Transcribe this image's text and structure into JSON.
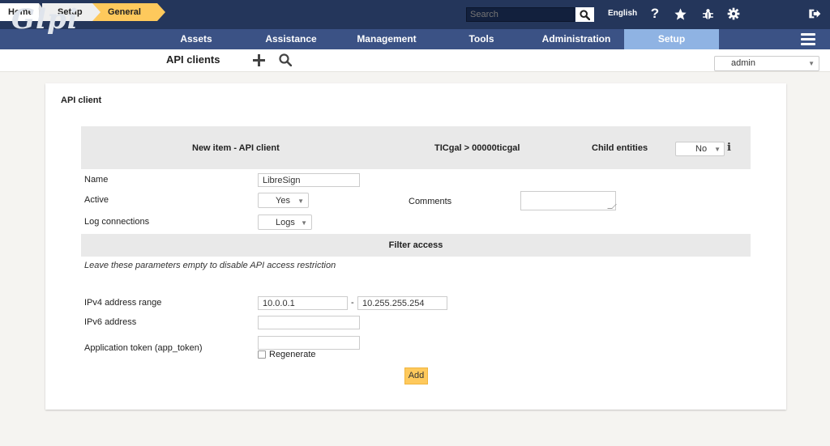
{
  "header": {
    "logo_text": "Glpi",
    "search_placeholder": "Search",
    "language": "English"
  },
  "menu": {
    "items": [
      {
        "label": "Assets"
      },
      {
        "label": "Assistance"
      },
      {
        "label": "Management"
      },
      {
        "label": "Tools"
      },
      {
        "label": "Administration"
      },
      {
        "label": "Setup"
      }
    ]
  },
  "breadcrumb": {
    "home": "Home",
    "setup": "Setup",
    "general": "General",
    "page_title": "API clients"
  },
  "profile_select": {
    "value": "admin"
  },
  "form": {
    "card_title": "API client",
    "header_title": "New item - API client",
    "entity": "TICgal > 00000ticgal",
    "child_entities_label": "Child entities",
    "child_entities_value": "No",
    "name_label": "Name",
    "name_value": "LibreSign",
    "active_label": "Active",
    "active_value": "Yes",
    "comments_label": "Comments",
    "log_label": "Log connections",
    "log_value": "Logs",
    "filter_title": "Filter access",
    "filter_hint": "Leave these parameters empty to disable API access restriction",
    "ipv4_label": "IPv4 address range",
    "ipv4_start": "10.0.0.1",
    "ipv4_separator": "-",
    "ipv4_end": "10.255.255.254",
    "ipv6_label": "IPv6 address",
    "ipv6_value": "",
    "token_label": "Application token (app_token)",
    "token_value": "",
    "regenerate_label": "Regenerate",
    "add_button": "Add"
  }
}
